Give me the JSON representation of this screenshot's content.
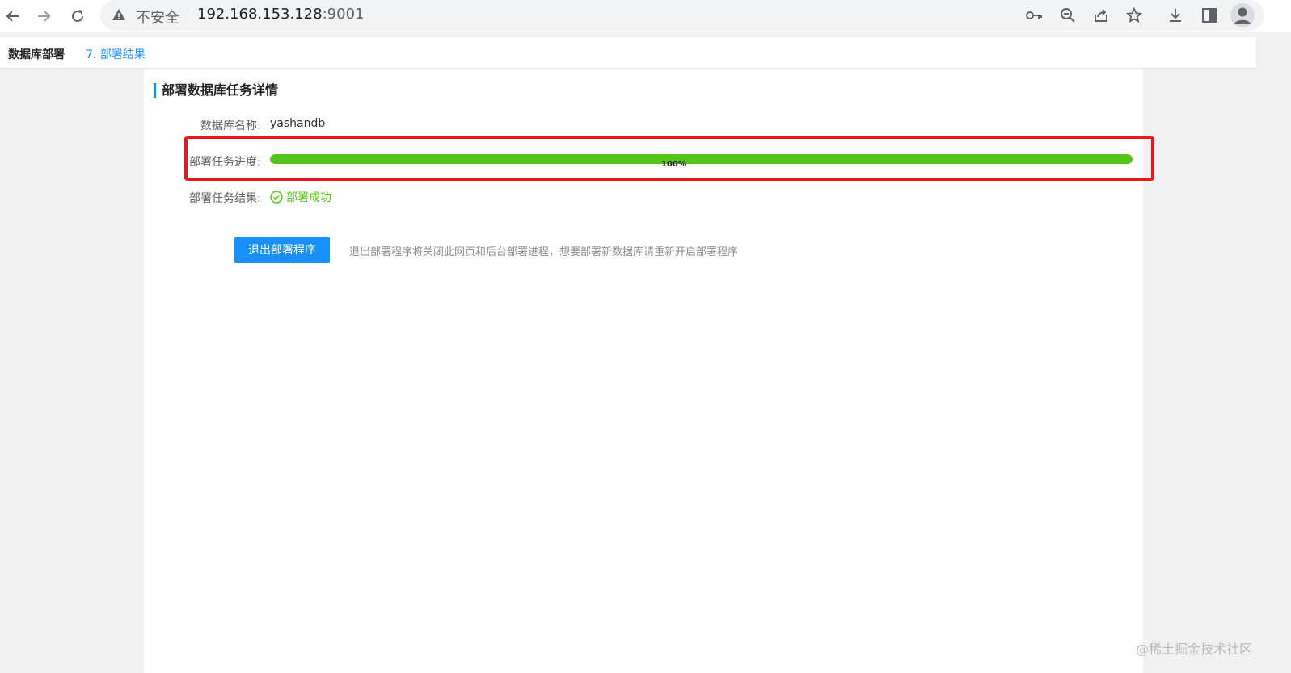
{
  "browser": {
    "insecure_label": "不安全",
    "url_host": "192.168.153.128",
    "url_port": ":9001",
    "icons": [
      "back-arrow-icon",
      "forward-arrow-icon",
      "reload-icon",
      "warning-icon",
      "key-icon",
      "zoom-icon",
      "share-icon",
      "star-icon",
      "download-icon",
      "side-panel-icon",
      "profile-icon"
    ]
  },
  "header": {
    "title": "数据库部署",
    "step": "7. 部署结果"
  },
  "section": {
    "title": "部署数据库任务详情"
  },
  "details": {
    "db_name_label": "数据库名称:",
    "db_name_value": "yashandb",
    "progress_label": "部署任务进度:",
    "progress_value": 1.0,
    "progress_text": "100%",
    "result_label": "部署任务结果:",
    "result_text": "部署成功"
  },
  "actions": {
    "exit_button": "退出部署程序",
    "exit_hint": "退出部署程序将关闭此网页和后台部署进程，想要部署新数据库请重新开启部署程序"
  },
  "watermark": "@稀土掘金技术社区",
  "colors": {
    "accent": "#1890ff",
    "success": "#52c41a",
    "highlight": "#e8191d"
  }
}
